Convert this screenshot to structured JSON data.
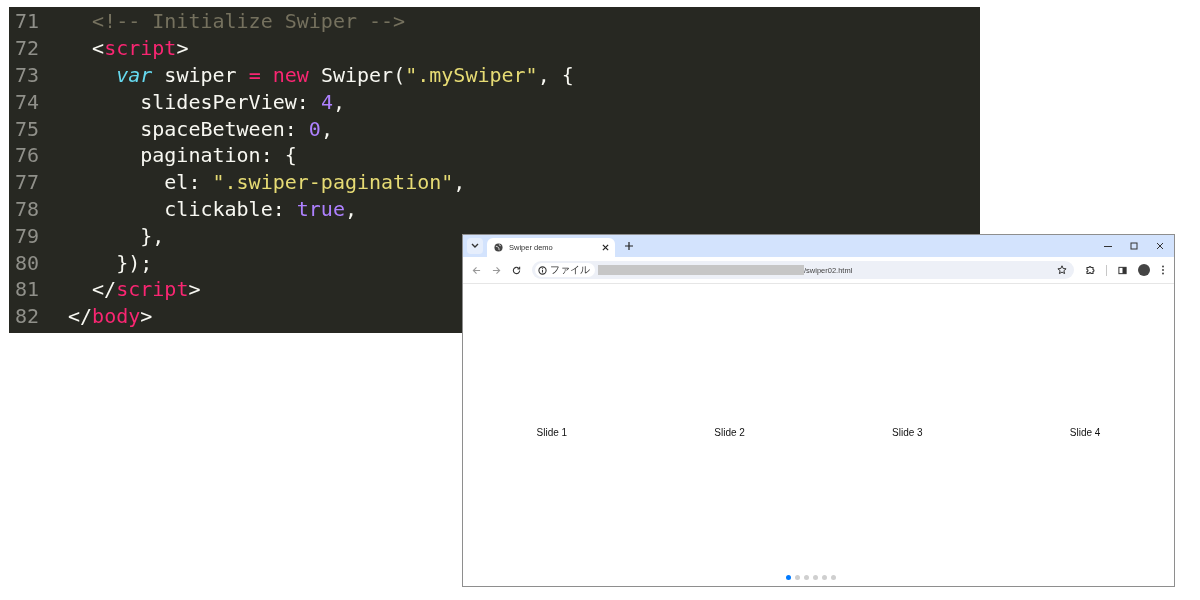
{
  "editor": {
    "lines": [
      {
        "number": "71",
        "tokens": [
          {
            "text": "  <!-- Initialize Swiper -->",
            "kind": "comment"
          }
        ]
      },
      {
        "number": "72",
        "tokens": [
          {
            "text": "  <",
            "kind": "plain"
          },
          {
            "text": "script",
            "kind": "tag"
          },
          {
            "text": ">",
            "kind": "plain"
          }
        ]
      },
      {
        "number": "73",
        "tokens": [
          {
            "text": "    var",
            "kind": "storage"
          },
          {
            "text": " swiper ",
            "kind": "plain"
          },
          {
            "text": "=",
            "kind": "keyword"
          },
          {
            "text": " new",
            "kind": "keyword"
          },
          {
            "text": " Swiper(",
            "kind": "plain"
          },
          {
            "text": "\".mySwiper\"",
            "kind": "string"
          },
          {
            "text": ", {",
            "kind": "plain"
          }
        ]
      },
      {
        "number": "74",
        "tokens": [
          {
            "text": "      slidesPerView: ",
            "kind": "plain"
          },
          {
            "text": "4",
            "kind": "number"
          },
          {
            "text": ",",
            "kind": "plain"
          }
        ]
      },
      {
        "number": "75",
        "tokens": [
          {
            "text": "      spaceBetween: ",
            "kind": "plain"
          },
          {
            "text": "0",
            "kind": "number"
          },
          {
            "text": ",",
            "kind": "plain"
          }
        ]
      },
      {
        "number": "76",
        "tokens": [
          {
            "text": "      pagination: {",
            "kind": "plain"
          }
        ]
      },
      {
        "number": "77",
        "tokens": [
          {
            "text": "        el: ",
            "kind": "plain"
          },
          {
            "text": "\".swiper-pagination\"",
            "kind": "string"
          },
          {
            "text": ",",
            "kind": "plain"
          }
        ]
      },
      {
        "number": "78",
        "tokens": [
          {
            "text": "        clickable: ",
            "kind": "plain"
          },
          {
            "text": "true",
            "kind": "number"
          },
          {
            "text": ",",
            "kind": "plain"
          }
        ]
      },
      {
        "number": "79",
        "tokens": [
          {
            "text": "      },",
            "kind": "plain"
          }
        ]
      },
      {
        "number": "80",
        "tokens": [
          {
            "text": "    });",
            "kind": "plain"
          }
        ]
      },
      {
        "number": "81",
        "tokens": [
          {
            "text": "  </",
            "kind": "plain"
          },
          {
            "text": "script",
            "kind": "tag"
          },
          {
            "text": ">",
            "kind": "plain"
          }
        ]
      },
      {
        "number": "82",
        "tokens": [
          {
            "text": "</",
            "kind": "plain"
          },
          {
            "text": "body",
            "kind": "tag"
          },
          {
            "text": ">",
            "kind": "plain"
          }
        ]
      }
    ]
  },
  "browser": {
    "tab": {
      "title": "Swiper demo"
    },
    "address": {
      "chip": "ファイル",
      "url": "/swiper02.html"
    },
    "slides": [
      {
        "label": "Slide 1"
      },
      {
        "label": "Slide 2"
      },
      {
        "label": "Slide 3"
      },
      {
        "label": "Slide 4"
      }
    ],
    "pagination": [
      {
        "selected": true
      },
      {
        "selected": false
      },
      {
        "selected": false
      },
      {
        "selected": false
      },
      {
        "selected": false
      },
      {
        "selected": false
      }
    ]
  }
}
